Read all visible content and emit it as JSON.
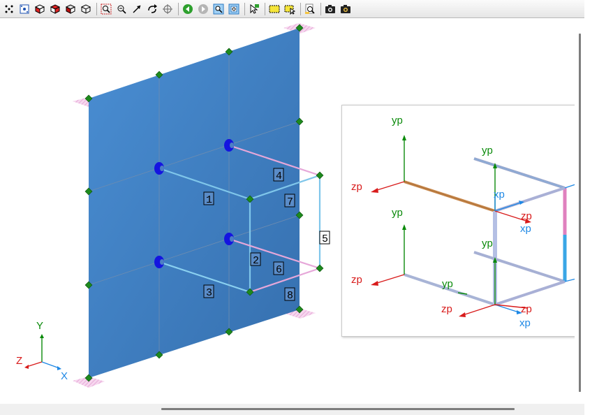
{
  "toolbar": {
    "buttons": [
      {
        "icon": "node-dots-icon"
      },
      {
        "icon": "node-box-icon"
      },
      {
        "icon": "solid-box-icon"
      },
      {
        "icon": "solid-box-red-icon"
      },
      {
        "icon": "solid-box-dark-icon"
      },
      {
        "icon": "wireframe-box-icon"
      },
      {
        "sep": true
      },
      {
        "icon": "zoom-window-icon"
      },
      {
        "icon": "zoom-out-icon"
      },
      {
        "icon": "zoom-arrow-icon"
      },
      {
        "icon": "rotate-icon"
      },
      {
        "icon": "crosshair-icon"
      },
      {
        "sep": true
      },
      {
        "icon": "back-green-icon"
      },
      {
        "icon": "forward-gray-icon"
      },
      {
        "icon": "zoom-fit-icon"
      },
      {
        "icon": "zoom-all-icon"
      },
      {
        "sep": true
      },
      {
        "icon": "select-cursor-icon"
      },
      {
        "sep": true
      },
      {
        "icon": "select-rect-icon"
      },
      {
        "icon": "select-rect-cursor-icon"
      },
      {
        "sep": true
      },
      {
        "icon": "find-icon"
      },
      {
        "sep": true
      },
      {
        "icon": "camera-icon"
      },
      {
        "icon": "camera-color-icon"
      }
    ]
  },
  "colors": {
    "plate": "#3f80c4",
    "node": "#1d8a1d",
    "local_x": "#1e88e5",
    "local_y": "#0a8a0a",
    "local_z": "#d81b1b"
  },
  "model": {
    "member_labels": [
      "1",
      "2",
      "3",
      "4",
      "5",
      "6",
      "7",
      "8"
    ]
  },
  "global_axes": {
    "x": "X",
    "y": "Y",
    "z": "Z"
  },
  "inset_axes": {
    "yp": "yp",
    "zp": "zp",
    "xp": "xp"
  }
}
